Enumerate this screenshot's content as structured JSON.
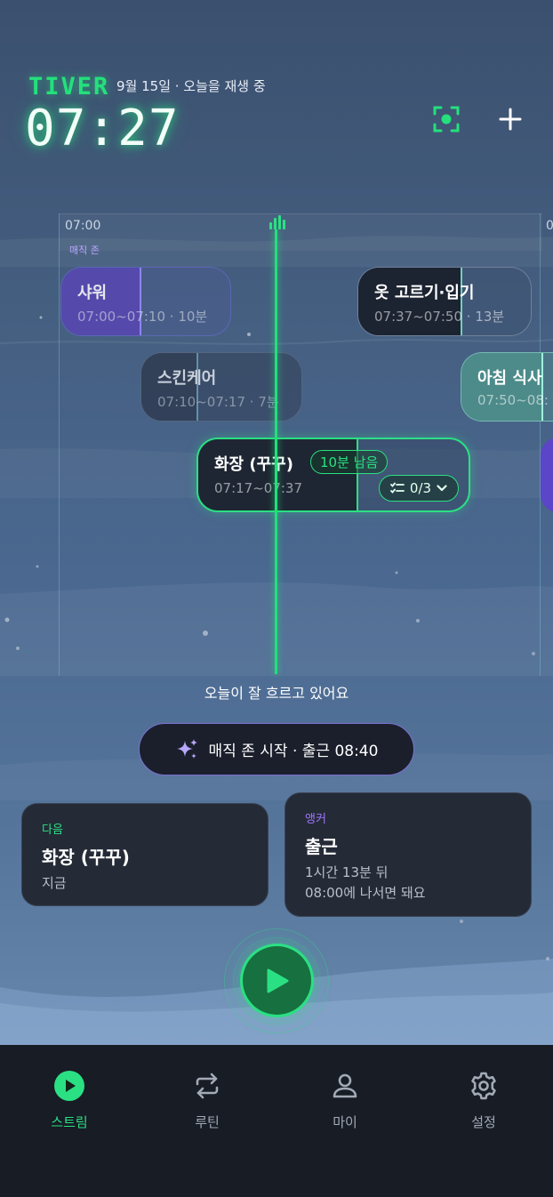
{
  "header": {
    "brand": "TIVER",
    "dateline": "9월 15일 · 오늘을 재생 중",
    "clock": "07:27"
  },
  "timeline": {
    "start_tick": "07:00",
    "end_tick_partial": "0",
    "zone_label": "매직 존",
    "tasks": [
      {
        "title": "샤워",
        "meta": "07:00~07:10 · 10분"
      },
      {
        "title": "스킨케어",
        "meta": "07:10~07:17 · 7분"
      },
      {
        "title": "화장 (꾸꾸)",
        "meta": "07:17~07:37",
        "badge": "10분 남음",
        "checklist": "0/3"
      },
      {
        "title": "옷 고르기·입기",
        "meta": "07:37~07:50 · 13분"
      },
      {
        "title": "아침 식사",
        "meta": "07:50~08:"
      }
    ]
  },
  "status_text": "오늘이 잘 흐르고 있어요",
  "magic_pill": "매직 존 시작 · 출근 08:40",
  "next_card": {
    "kicker": "다음",
    "title": "화장 (꾸꾸)",
    "sub": "지금"
  },
  "anchor_card": {
    "kicker": "앵커",
    "title": "출근",
    "line1": "1시간 13분 뒤",
    "line2": "08:00에 나서면 돼요"
  },
  "nav": [
    {
      "label": "스트림",
      "icon": "play-circle-icon"
    },
    {
      "label": "루틴",
      "icon": "repeat-icon"
    },
    {
      "label": "마이",
      "icon": "person-icon"
    },
    {
      "label": "설정",
      "icon": "gear-icon"
    }
  ],
  "colors": {
    "accent": "#2be083",
    "magic": "#9b8cff",
    "anchor_kicker": "#a274ff",
    "background_top": "#3b506e",
    "nav_bg": "#171c25"
  }
}
